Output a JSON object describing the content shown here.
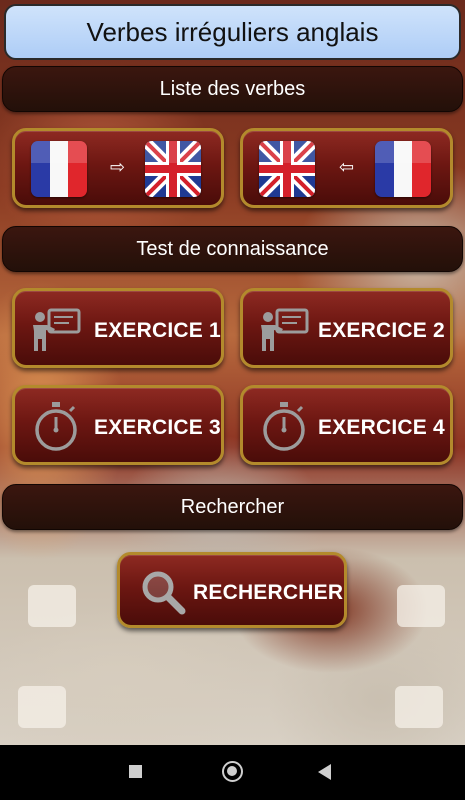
{
  "app": {
    "title": "Verbes irréguliers anglais"
  },
  "sections": {
    "list": "Liste des verbes",
    "test": "Test de connaissance",
    "search": "Rechercher"
  },
  "translate": {
    "fr_to_en_arrow": "⇨",
    "en_to_fr_arrow": "⇦"
  },
  "exercises": [
    {
      "label": "EXERCICE 1",
      "icon": "teacher-board-icon"
    },
    {
      "label": "EXERCICE 2",
      "icon": "teacher-board-icon"
    },
    {
      "label": "EXERCICE 3",
      "icon": "stopwatch-icon"
    },
    {
      "label": "EXERCICE 4",
      "icon": "stopwatch-icon"
    }
  ],
  "search_button": {
    "label": "RECHERCHER",
    "icon": "magnifier-icon"
  },
  "colors": {
    "title_bg": "#aecdf6",
    "section_bg": "#2b120b",
    "button_bg": "#6d1712",
    "button_border": "#b38a2c"
  }
}
